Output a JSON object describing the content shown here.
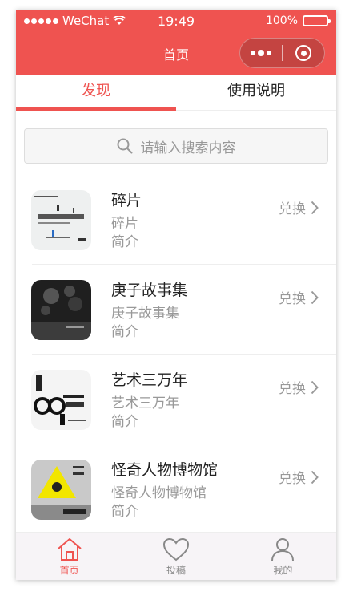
{
  "status_bar": {
    "carrier": "WeChat",
    "time": "19:49",
    "battery": "100%"
  },
  "navbar": {
    "title": "首页"
  },
  "tabs": [
    {
      "label": "发现",
      "active": true
    },
    {
      "label": "使用说明",
      "active": false
    }
  ],
  "search": {
    "placeholder": "请输入搜索内容"
  },
  "items": [
    {
      "title": "碎片",
      "subtitle": "碎片",
      "desc": "简介",
      "action": "兑换",
      "cover": "book-cover-fragments"
    },
    {
      "title": "庚子故事集",
      "subtitle": "庚子故事集",
      "desc": "简介",
      "action": "兑换",
      "cover": "book-cover-gengzi-stories"
    },
    {
      "title": "艺术三万年",
      "subtitle": "艺术三万年",
      "desc": "简介",
      "action": "兑换",
      "cover": "book-cover-art-30000-years"
    },
    {
      "title": "怪奇人物博物馆",
      "subtitle": "怪奇人物博物馆",
      "desc": "简介",
      "action": "兑换",
      "cover": "book-cover-museum-of-curious-people"
    }
  ],
  "tabbar": [
    {
      "label": "首页",
      "icon": "home-icon",
      "active": true
    },
    {
      "label": "投稿",
      "icon": "heart-icon",
      "active": false
    },
    {
      "label": "我的",
      "icon": "user-icon",
      "active": false
    }
  ],
  "colors": {
    "accent": "#ef5350",
    "muted": "#999999"
  }
}
